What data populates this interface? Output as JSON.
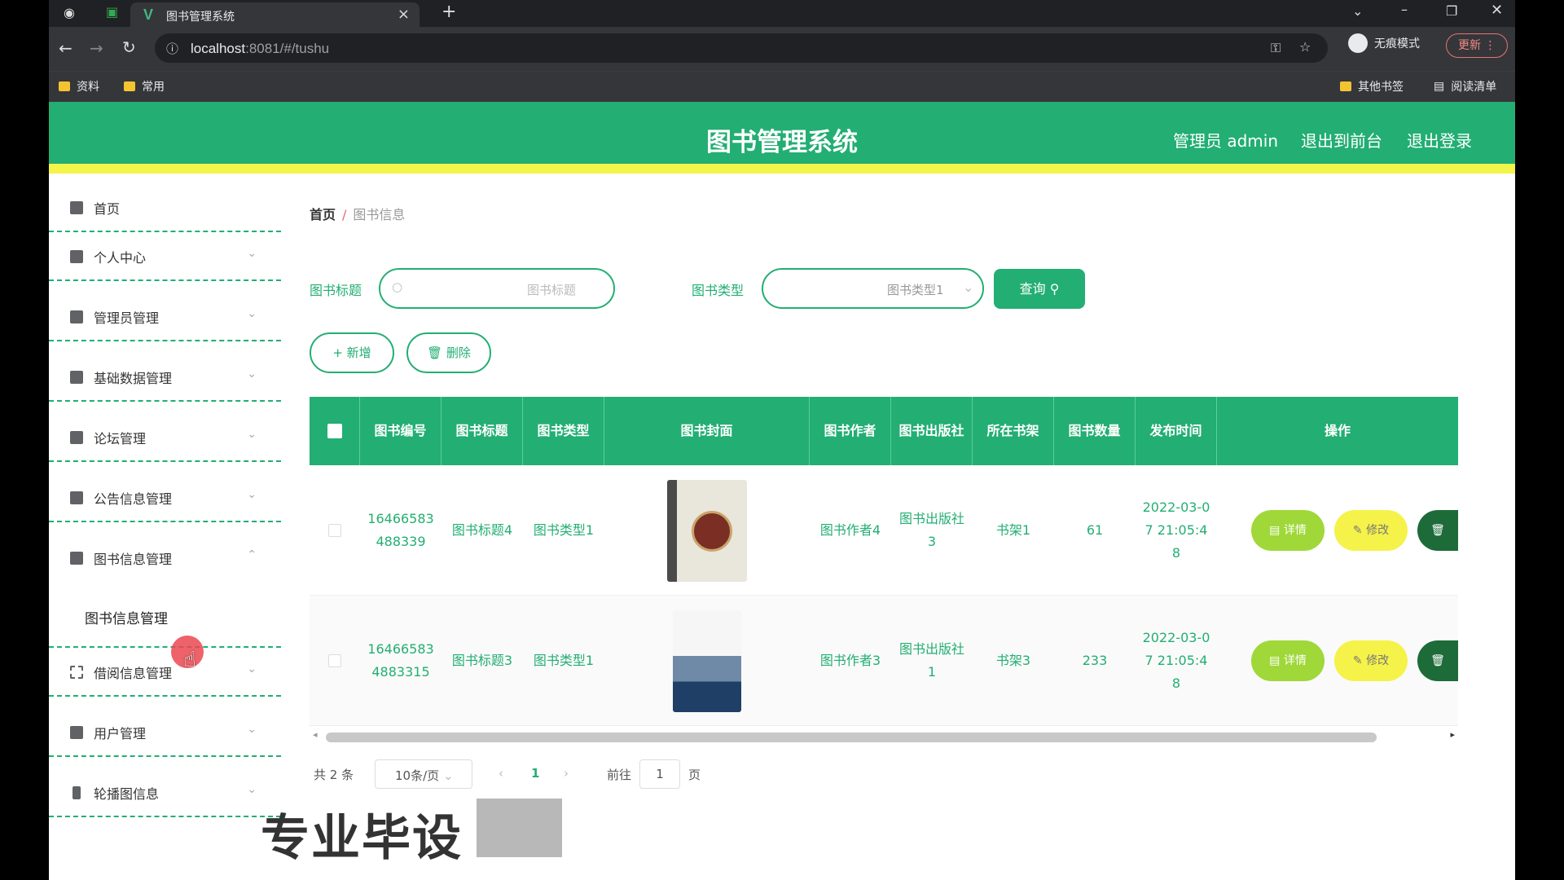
{
  "browser": {
    "tab_title": "图书管理系统",
    "url_host": "localhost",
    "url_rest": ":8081/#/tushu",
    "bookmarks_left": [
      "资料",
      "常用"
    ],
    "bookmarks_right": [
      "其他书签",
      "阅读清单"
    ],
    "incognito_label": "无痕模式",
    "update_label": "更新"
  },
  "header": {
    "title": "图书管理系统",
    "admin": "管理员 admin",
    "to_front": "退出到前台",
    "logout": "退出登录",
    "color": "#23ae73",
    "stripe_color": "#f3f54a"
  },
  "sidebar": {
    "items": [
      {
        "label": "首页",
        "icon": "home-icon"
      },
      {
        "label": "个人中心",
        "icon": "user-icon"
      },
      {
        "label": "管理员管理",
        "icon": "flag-icon"
      },
      {
        "label": "基础数据管理",
        "icon": "chart-icon"
      },
      {
        "label": "论坛管理",
        "icon": "user-icon"
      },
      {
        "label": "公告信息管理",
        "icon": "send-icon"
      },
      {
        "label": "图书信息管理",
        "icon": "box-icon"
      },
      {
        "label": "借阅信息管理",
        "icon": "fullscreen-icon"
      },
      {
        "label": "用户管理",
        "icon": "document-icon"
      },
      {
        "label": "轮播图信息",
        "icon": "phone-icon"
      }
    ],
    "submenu_item": "图书信息管理"
  },
  "breadcrumb": {
    "home": "首页",
    "sep": "/",
    "current": "图书信息"
  },
  "search": {
    "title_label": "图书标题",
    "title_placeholder": "图书标题",
    "type_label": "图书类型",
    "type_value": "图书类型1",
    "query_label": "查询"
  },
  "actions": {
    "add": "+ 新增",
    "delete": "删除"
  },
  "table": {
    "headers": [
      "图书编号",
      "图书标题",
      "图书类型",
      "图书封面",
      "图书作者",
      "图书出版社",
      "所在书架",
      "图书数量",
      "发布时间",
      "操作"
    ],
    "rows": [
      {
        "id": "16466583488339",
        "title": "图书标题4",
        "type": "图书类型1",
        "author": "图书作者4",
        "publisher": "图书出版社3",
        "shelf": "书架1",
        "qty": "61",
        "time": "2022-03-07 21:05:48"
      },
      {
        "id": "164665834883315",
        "title": "图书标题3",
        "type": "图书类型1",
        "author": "图书作者3",
        "publisher": "图书出版社1",
        "shelf": "书架3",
        "qty": "233",
        "time": "2022-03-07 21:05:48"
      }
    ],
    "detail_label": "详情",
    "edit_label": "修改"
  },
  "pagination": {
    "total": "共 2 条",
    "page_size": "10条/页",
    "current": "1",
    "goto_prefix": "前往",
    "goto_value": "1",
    "goto_suffix": "页"
  },
  "watermark": "专业毕设"
}
